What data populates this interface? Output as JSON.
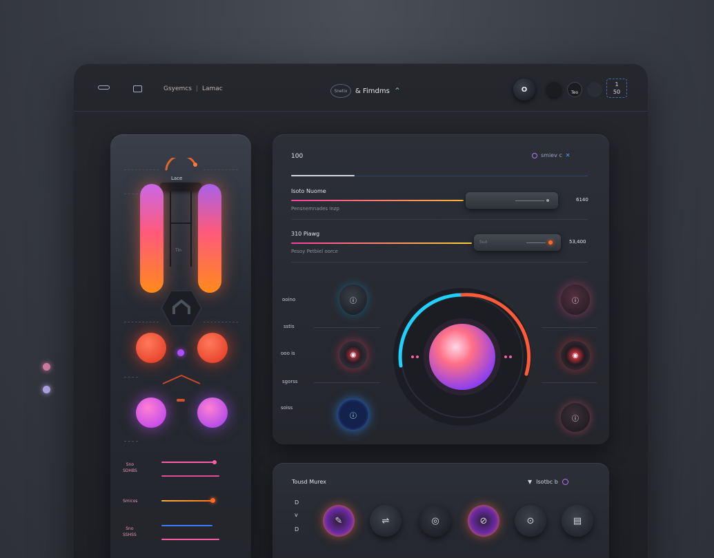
{
  "topbar": {
    "breadcrumb": [
      "Gsyemcs",
      "Lamac"
    ],
    "brand_logo_text": "Snetix",
    "brand_name": "& Fimdms",
    "button_o_label": "O",
    "dial_label": "Teo",
    "badge_label_top": "1",
    "badge_label_bottom": "50"
  },
  "main": {
    "header_value": "100",
    "header_right_label": "smiev c",
    "row1": {
      "title": "Isoto Nuome",
      "subtitle": "Pensnemnades Inzp",
      "value": "6140"
    },
    "row2": {
      "title": "310 Piawg",
      "subtitle": "Pesoy   Petbiel   oorce",
      "slider_text": "Suo",
      "value": "53,400"
    },
    "controls_left": [
      "ooino",
      "sstis",
      "ooo is",
      "sgorss",
      "soiss"
    ]
  },
  "bottom": {
    "title": "Tousd Murex",
    "right_label": "Isotbc  b",
    "side_markers": [
      "D",
      "v",
      "D"
    ]
  },
  "left_panel": {
    "gauge_label": "Lace",
    "mid_label": "Tin",
    "labels": [
      [
        "Sno",
        "SDHBS"
      ],
      [
        "Smicos"
      ],
      [
        "Sno",
        "SSHSS"
      ]
    ]
  },
  "colors": {
    "accent_orange": "#ff7a1f",
    "accent_pink": "#ff5fa8",
    "accent_cyan": "#2ad4ff",
    "accent_purple": "#b45cff",
    "bg": "#1d1f24"
  }
}
